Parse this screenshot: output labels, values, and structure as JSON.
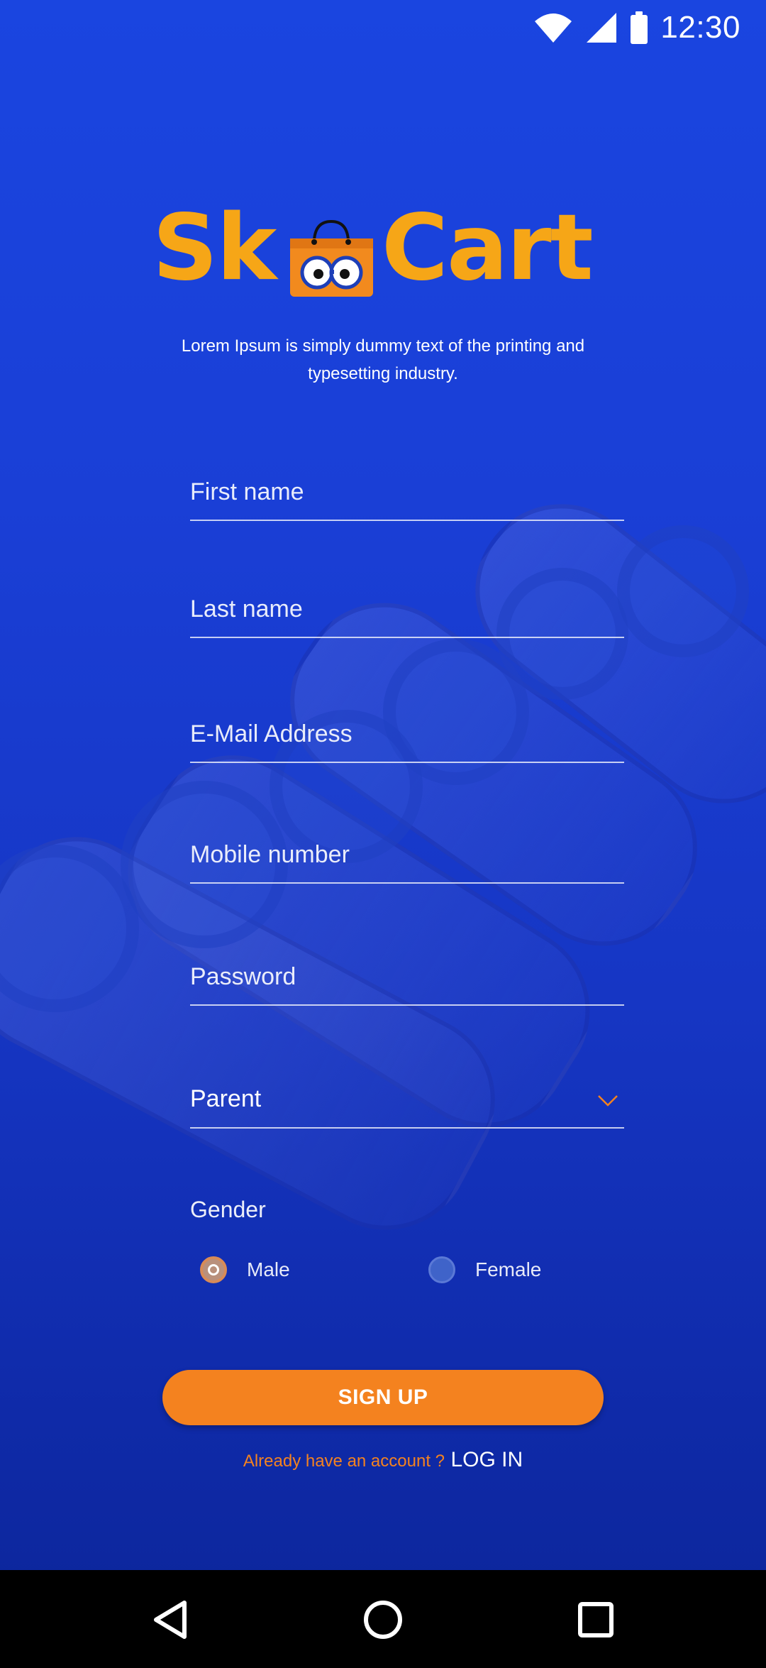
{
  "status_bar": {
    "time": "12:30"
  },
  "logo": {
    "text_left": "Sk",
    "text_right": "Cart",
    "brand_color": "#f6a617"
  },
  "tagline": "Lorem Ipsum is simply dummy text of the printing and typesetting industry.",
  "form": {
    "first_name": {
      "placeholder": "First name",
      "value": ""
    },
    "last_name": {
      "placeholder": "Last name",
      "value": ""
    },
    "email": {
      "placeholder": "E-Mail Address",
      "value": ""
    },
    "mobile": {
      "placeholder": "Mobile number",
      "value": ""
    },
    "password": {
      "placeholder": "Password",
      "value": ""
    },
    "role": {
      "selected": "Parent"
    },
    "gender": {
      "label": "Gender",
      "options": [
        {
          "label": "Male",
          "selected": true
        },
        {
          "label": "Female",
          "selected": false
        }
      ]
    }
  },
  "signup_button": {
    "label": "SIGN UP",
    "color": "#f4821f"
  },
  "login": {
    "question": "Already have an account ?",
    "link": "LOG IN"
  },
  "nav_bar": {
    "icons": [
      "back-icon",
      "home-icon",
      "recents-icon"
    ]
  }
}
